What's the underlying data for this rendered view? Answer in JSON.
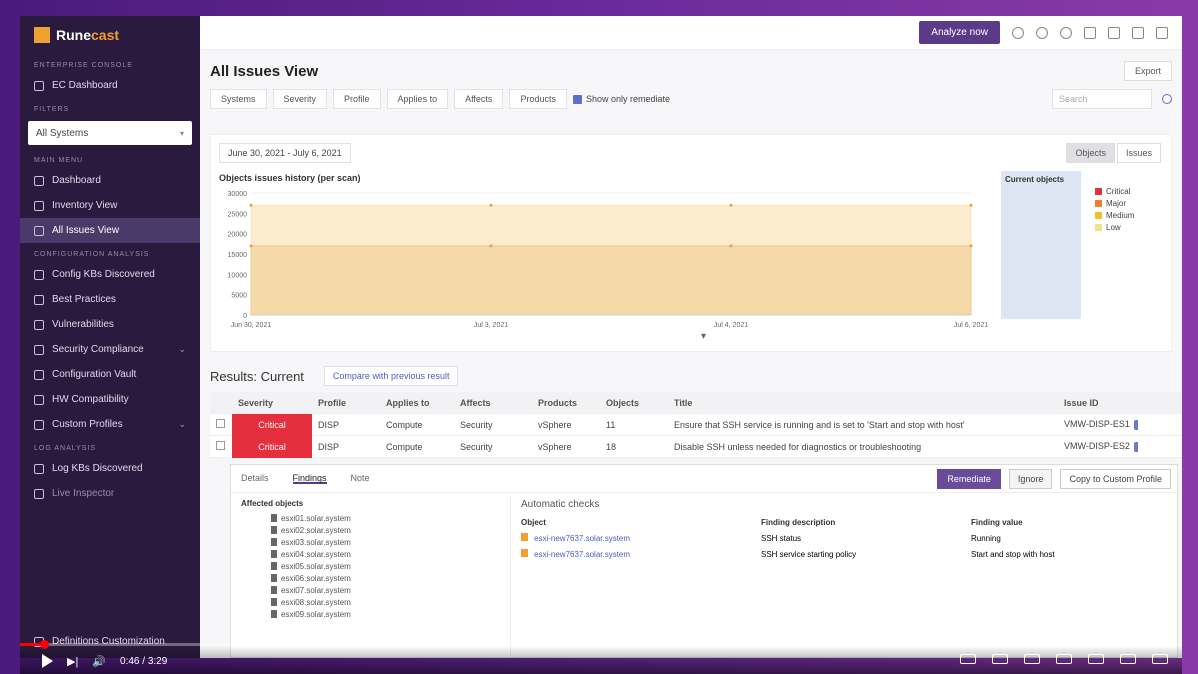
{
  "brand": {
    "name_a": "Rune",
    "name_b": "cast"
  },
  "sidebar": {
    "sections": [
      {
        "title": "Enterprise Console"
      },
      {
        "title": "Filters"
      },
      {
        "title": "Main Menu"
      },
      {
        "title": "Configuration Analysis"
      },
      {
        "title": "Log Analysis"
      }
    ],
    "ec_dashboard": "EC Dashboard",
    "systems_select": "All Systems",
    "main_items": [
      "Dashboard",
      "Inventory View",
      "All Issues View"
    ],
    "config_items": [
      "Config KBs Discovered",
      "Best Practices",
      "Vulnerabilities",
      "Security Compliance",
      "Configuration Vault",
      "HW Compatibility",
      "Custom Profiles"
    ],
    "log_items": [
      "Log KBs Discovered",
      "Live Inspector"
    ],
    "footer": "Definitions Customization"
  },
  "topbar": {
    "analyze_label": "Analyze now"
  },
  "page": {
    "title": "All Issues View",
    "export_label": "Export"
  },
  "filters": {
    "items": [
      "Systems",
      "Severity",
      "Profile",
      "Applies to",
      "Affects",
      "Products"
    ],
    "show_remediate": "Show only remediate",
    "search_placeholder": "Search"
  },
  "chart": {
    "date_range": "June 30, 2021 - July 6, 2021",
    "title": "Objects issues history (per scan)",
    "toggle_objects": "Objects",
    "toggle_issues": "Issues",
    "current_title": "Current objects",
    "legend": [
      {
        "label": "Critical",
        "color": "#e52e3e"
      },
      {
        "label": "Major",
        "color": "#f07f30"
      },
      {
        "label": "Medium",
        "color": "#f2c02a"
      },
      {
        "label": "Low",
        "color": "#f7e08a"
      }
    ]
  },
  "chart_data": {
    "type": "area",
    "x": [
      "Jun 30, 2021",
      "Jul 3, 2021",
      "Jul 4, 2021",
      "Jul 6, 2021"
    ],
    "yticks": [
      0,
      5000,
      10000,
      15000,
      20000,
      25000,
      30000
    ],
    "ylim": [
      0,
      30000
    ],
    "series": [
      {
        "name": "Major",
        "values": [
          17000,
          17000,
          17000,
          17000
        ]
      },
      {
        "name": "Medium",
        "values": [
          27000,
          27000,
          27000,
          27000
        ]
      }
    ],
    "current": {
      "yticks": [
        0,
        5000,
        10000,
        15000,
        20000,
        25000,
        30000
      ],
      "major": 17000,
      "medium": 27000
    }
  },
  "results": {
    "title": "Results: Current",
    "compare_label": "Compare with previous result"
  },
  "table": {
    "headers": [
      "Severity",
      "Profile",
      "Applies to",
      "Affects",
      "Products",
      "Objects",
      "Title",
      "Issue ID"
    ],
    "rows": [
      {
        "severity": "Critical",
        "profile": "DISP",
        "applies": "Compute",
        "affects": "Security",
        "products": "vSphere",
        "objects": "11",
        "title": "Ensure that SSH service is running and is set to 'Start and stop with host'",
        "issue_id": "VMW-DISP-ES1"
      },
      {
        "severity": "Critical",
        "profile": "DISP",
        "applies": "Compute",
        "affects": "Security",
        "products": "vSphere",
        "objects": "18",
        "title": "Disable SSH unless needed for diagnostics or troubleshooting",
        "issue_id": "VMW-DISP-ES2"
      }
    ]
  },
  "detail": {
    "tabs": [
      "Details",
      "Findings",
      "Note"
    ],
    "remediate": "Remediate",
    "ignore": "Ignore",
    "copy": "Copy to Custom Profile",
    "affected_title": "Affected objects",
    "tree": [
      "esxi01.solar.system",
      "esxi02.solar.system",
      "esxi03.solar.system",
      "esxi04.solar.system",
      "esxi05.solar.system",
      "esxi06.solar.system",
      "esxi07.solar.system",
      "esxi08.solar.system",
      "esxi09.solar.system"
    ],
    "auto_title": "Automatic checks",
    "auto_headers": [
      "Object",
      "Finding description",
      "Finding value"
    ],
    "auto_rows": [
      {
        "object": "esxi-new7637.solar.system",
        "desc": "SSH status",
        "value": "Running"
      },
      {
        "object": "esxi-new7637.solar.system",
        "desc": "SSH service starting policy",
        "value": "Start and stop with host"
      }
    ]
  },
  "video": {
    "time": "0:46 / 3:29"
  }
}
